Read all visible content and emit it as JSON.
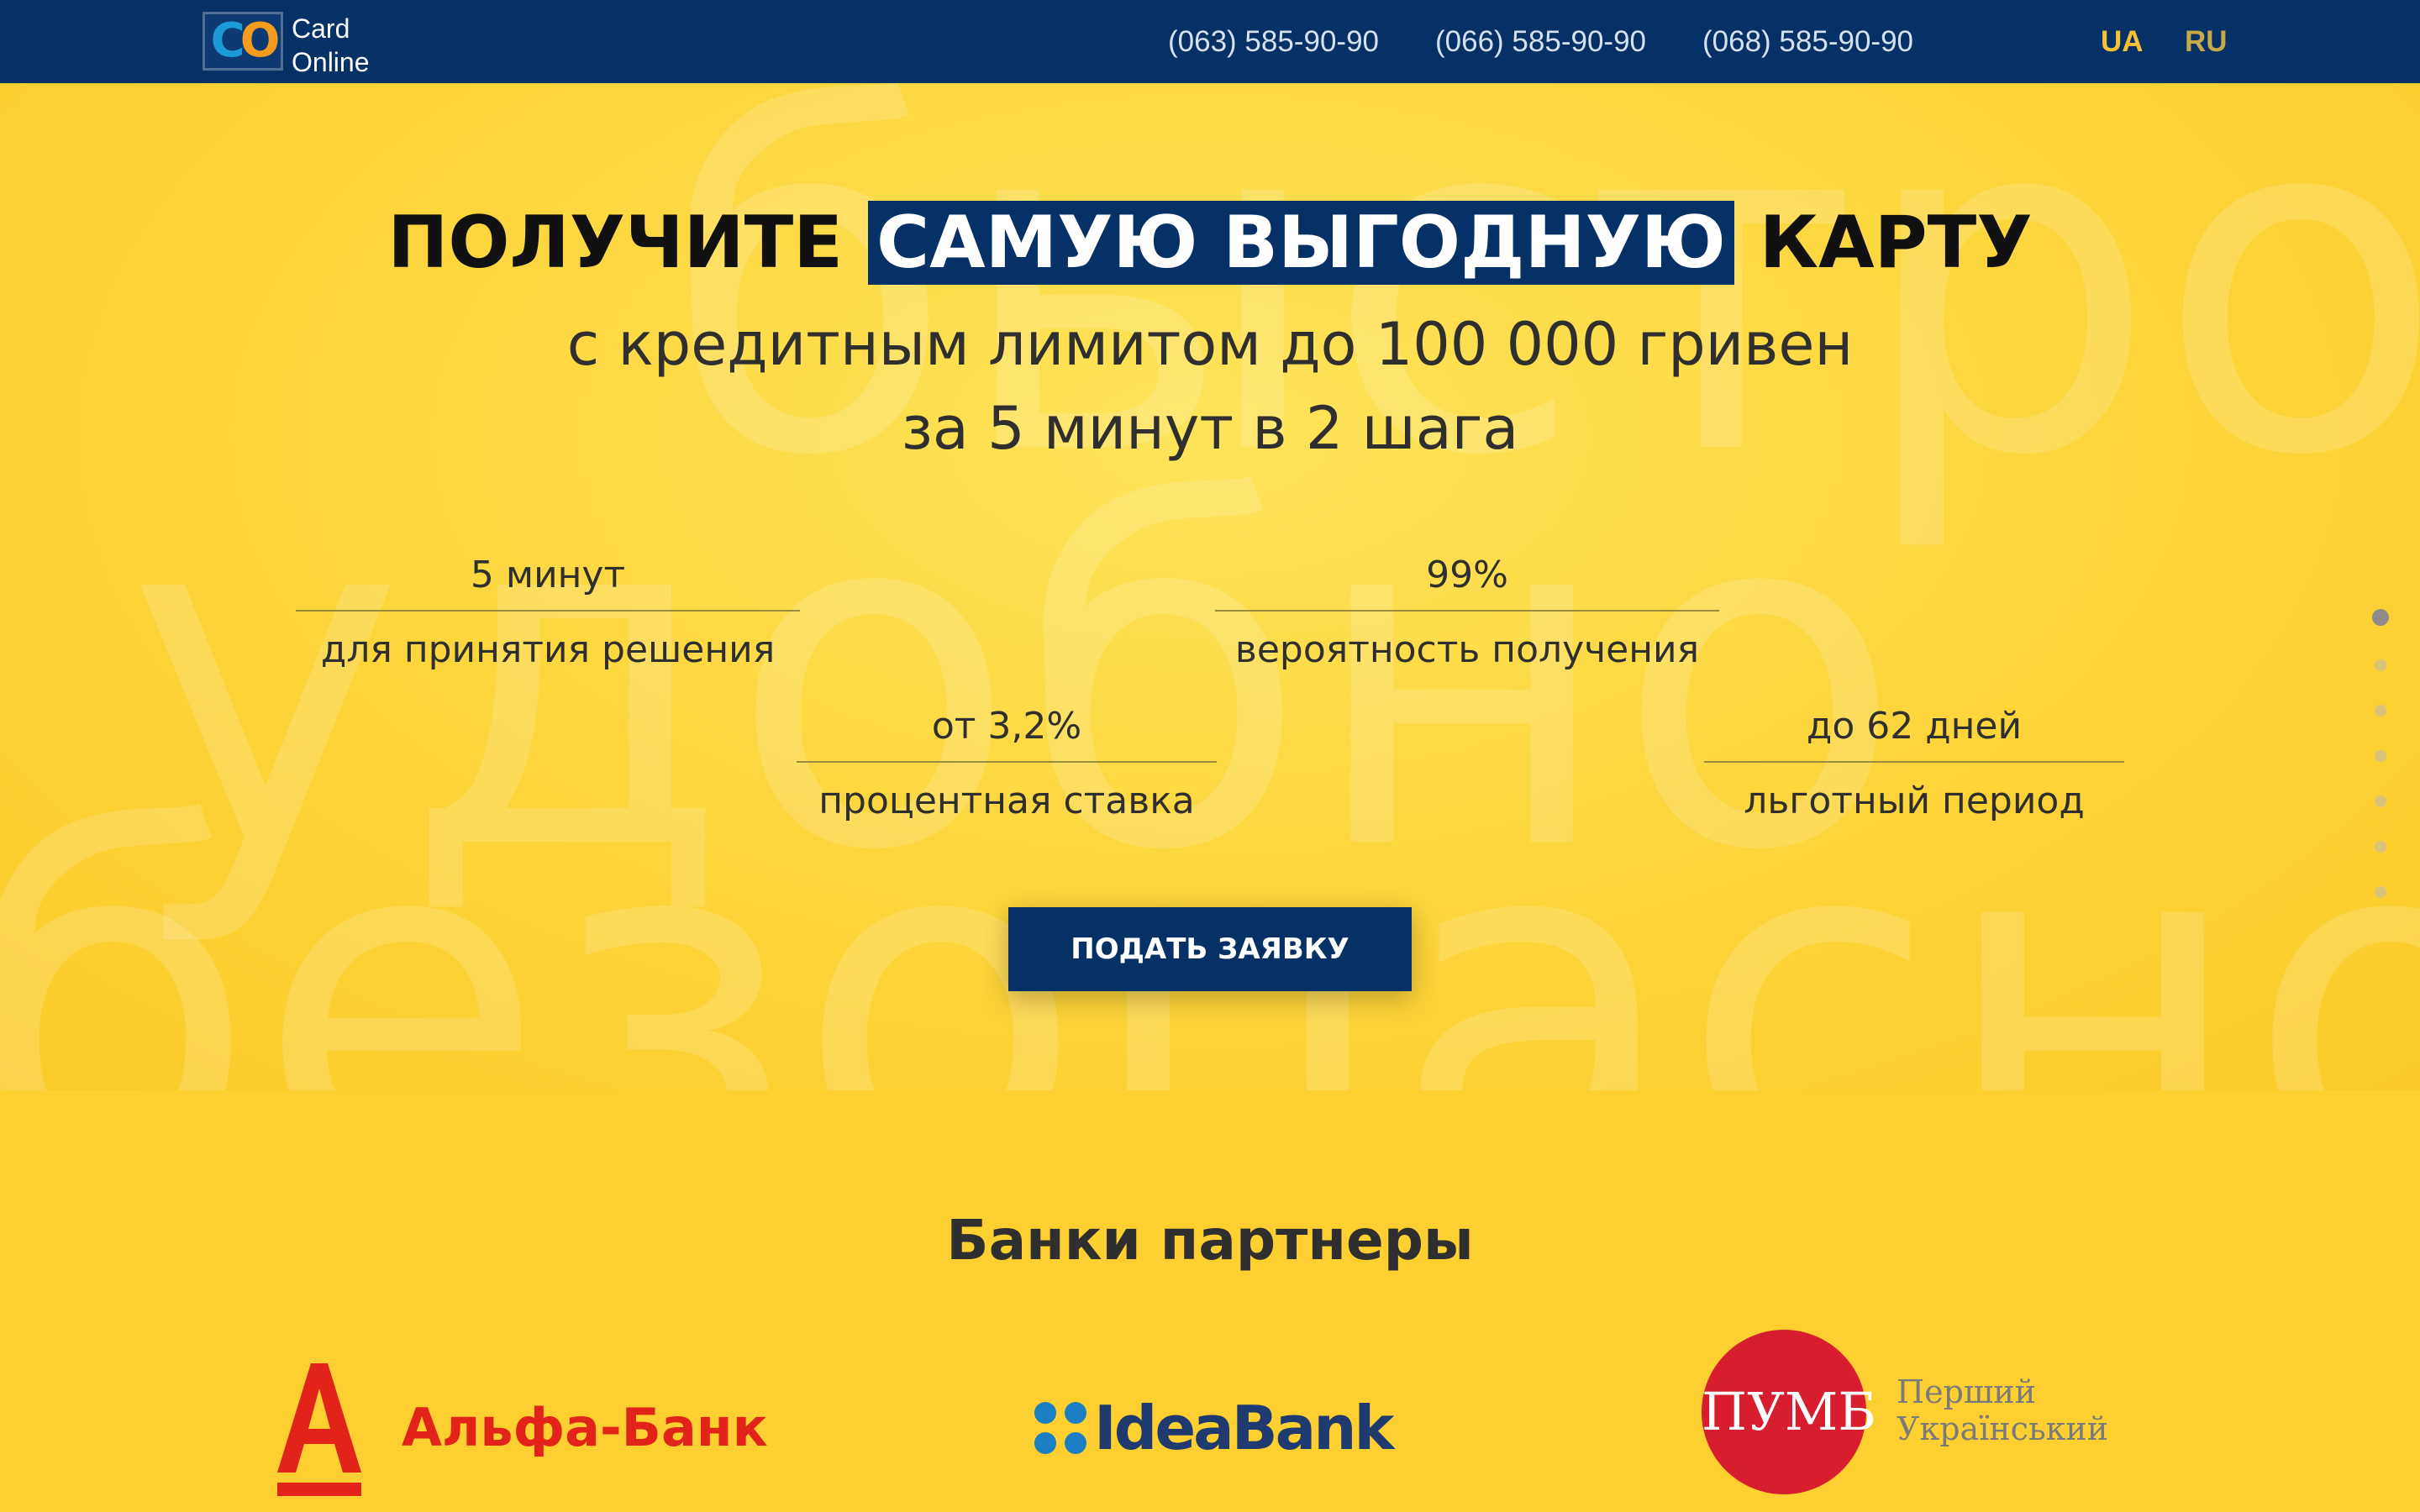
{
  "header": {
    "logo": {
      "mark": "CO",
      "line1": "Card",
      "line2": "Online"
    },
    "phones": [
      "(063) 585-90-90",
      "(066) 585-90-90",
      "(068) 585-90-90"
    ],
    "languages": {
      "ua": "UA",
      "ru": "RU",
      "active": "UA"
    }
  },
  "hero": {
    "background_words": [
      "быстро",
      "удобно",
      "безопасно"
    ],
    "title_before": "ПОЛУЧИТЕ",
    "title_highlight": "САМУЮ ВЫГОДНУЮ",
    "title_after": "КАРТУ",
    "subtitle_line1": "с кредитным лимитом до 100 000 гривен",
    "subtitle_line2": "за 5 минут в 2 шага",
    "stats": [
      {
        "value": "5 минут",
        "label": "для принятия решения"
      },
      {
        "value": "99%",
        "label": "вероятность получения"
      },
      {
        "value": "от 3,2%",
        "label": "процентная ставка"
      },
      {
        "value": "до 62 дней",
        "label": "льготный период"
      }
    ],
    "cta_label": "ПОДАТЬ ЗАЯВКУ",
    "pagination": {
      "count": 7,
      "active_index": 0
    }
  },
  "partners": {
    "title": "Банки партнеры",
    "banks": [
      {
        "name": "Альфа-Банк",
        "mark": "А",
        "color": "#e2231a"
      },
      {
        "name": "IdeaBank",
        "color": "#1e3a6e",
        "accent": "#1b7fc4"
      },
      {
        "mark": "ПУМБ",
        "name_line1": "Перший",
        "name_line2": "Український",
        "color": "#d81e2e"
      }
    ]
  },
  "colors": {
    "navy": "#053166",
    "yellow": "#fdd033",
    "text": "#2f2f2f"
  }
}
